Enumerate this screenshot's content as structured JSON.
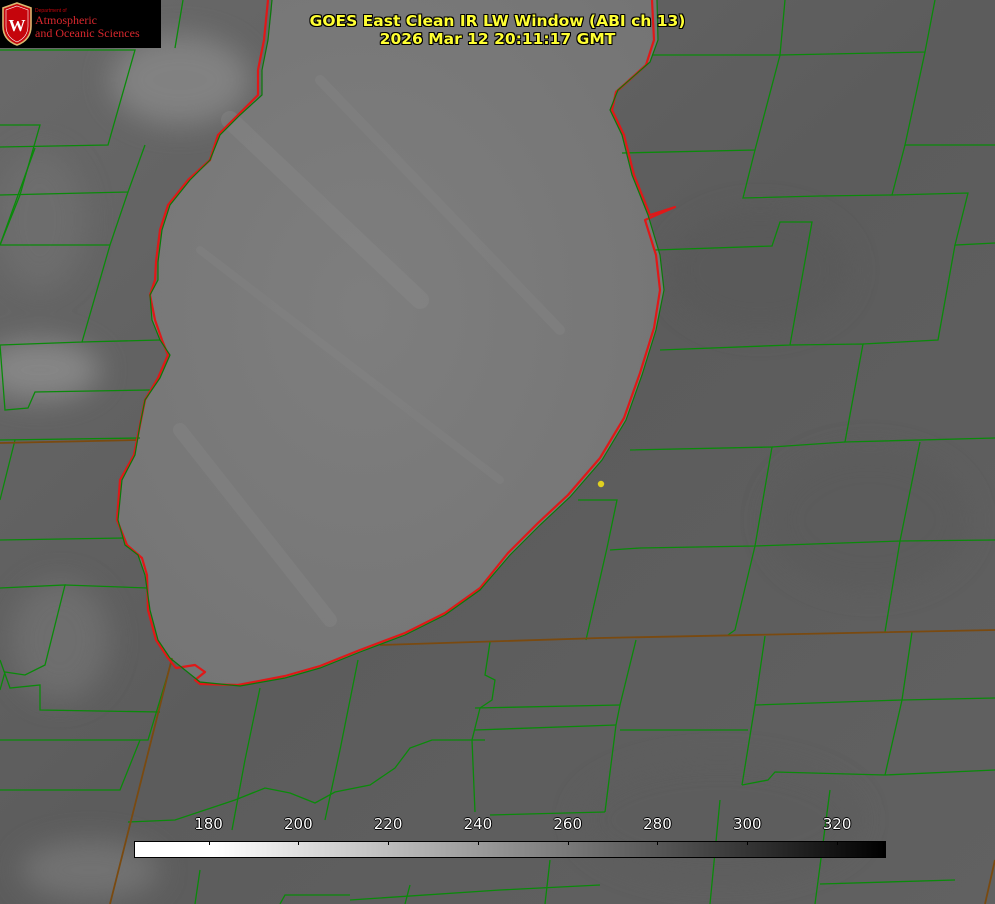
{
  "title": {
    "line1": "GOES East Clean IR LW Window (ABI ch 13)",
    "line2": "2026 Mar 12 20:11:17 GMT"
  },
  "logo": {
    "dept_label": "Department of",
    "line1": "Atmospheric",
    "line2": "and Oceanic Sciences",
    "crest_letter": "W",
    "crest_color": "#c5050c"
  },
  "colorbar": {
    "ticks": [
      {
        "label": "180",
        "value": 180
      },
      {
        "label": "200",
        "value": 200
      },
      {
        "label": "220",
        "value": 220
      },
      {
        "label": "240",
        "value": 240
      },
      {
        "label": "260",
        "value": 260
      },
      {
        "label": "280",
        "value": 280
      },
      {
        "label": "300",
        "value": 300
      },
      {
        "label": "320",
        "value": 320
      }
    ],
    "colors": {
      "low": "#ffffff",
      "high": "#000000"
    }
  },
  "map": {
    "boundary_color": "#008000",
    "coastline_color": "#e01010",
    "marker_color": "#e0d020",
    "lake_gray": "#7a7a7a",
    "land_gray": "#5e5e5e"
  }
}
